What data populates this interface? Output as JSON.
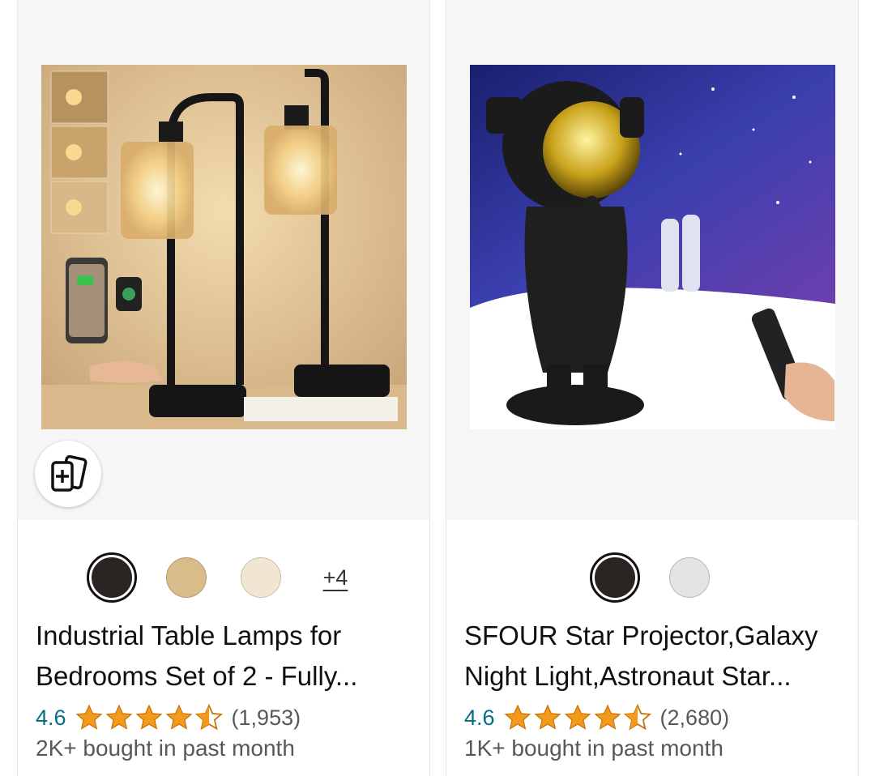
{
  "products": [
    {
      "title": "Industrial Table Lamps for Bedrooms Set of 2 - Fully...",
      "rating": "4.6",
      "stars": 4.5,
      "review_count": "(1,953)",
      "bought": "2K+ bought in past month",
      "more_colors": "+4",
      "swatches": [
        "#2a2422",
        "#d8bd8a",
        "#f1e6d2"
      ]
    },
    {
      "title": "SFOUR Star Projector,Galaxy Night Light,Astronaut Star...",
      "rating": "4.6",
      "stars": 4.5,
      "review_count": "(2,680)",
      "bought": "1K+ bought in past month",
      "swatches": [
        "#2a2422",
        "#e6e4e3"
      ]
    }
  ],
  "colors": {
    "star": "#f49a1a",
    "rating_text": "#007185",
    "muted_text": "#565959"
  }
}
